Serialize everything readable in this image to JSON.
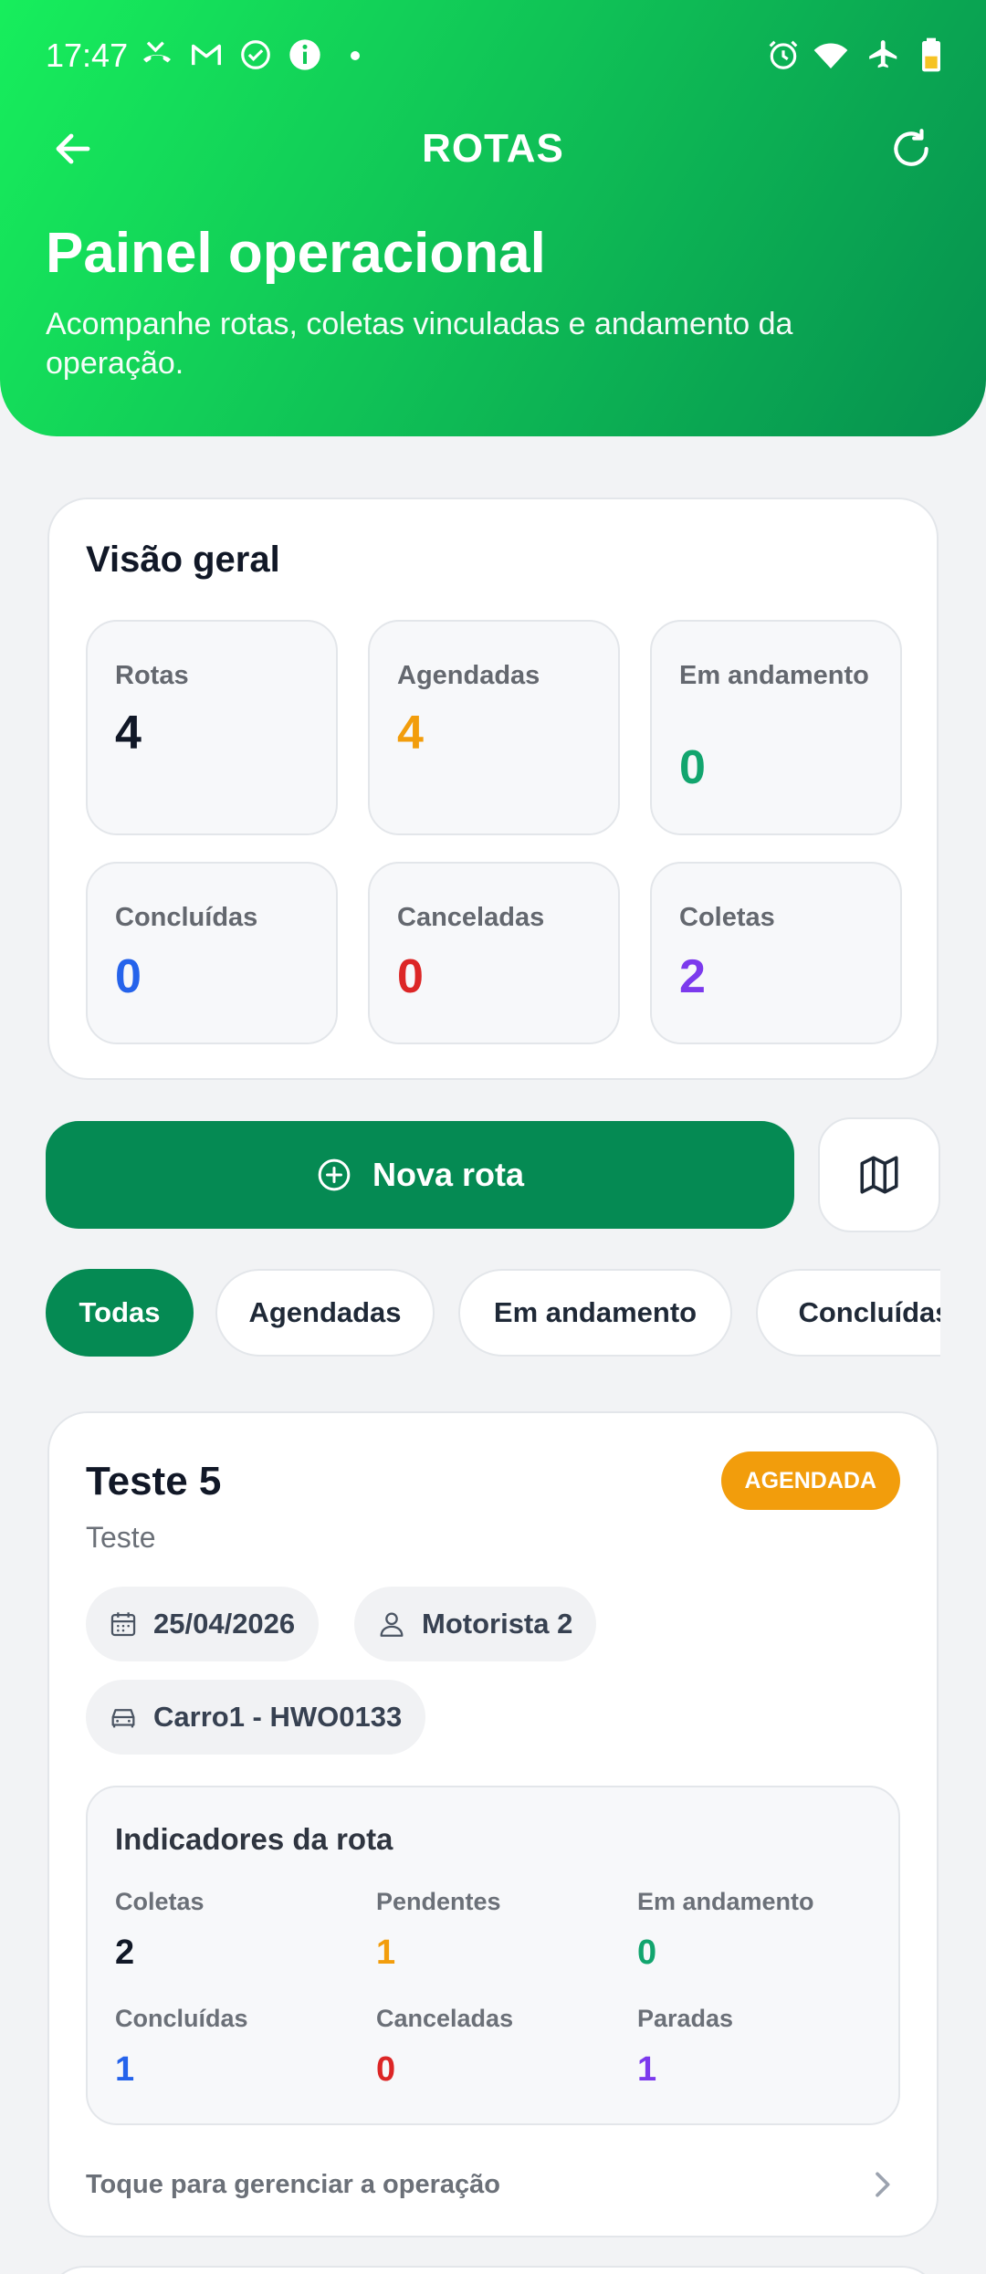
{
  "status_bar": {
    "time": "17:47",
    "left_icons": [
      "missed-call-icon",
      "gmail-icon",
      "check-circle-icon",
      "info-icon",
      "dot-icon"
    ],
    "right_icons": [
      "alarm-icon",
      "wifi-icon",
      "airplane-icon",
      "battery-icon"
    ]
  },
  "topbar": {
    "title": "ROTAS",
    "back_icon": "arrow-left-icon",
    "refresh_icon": "refresh-icon"
  },
  "hero": {
    "title": "Painel operacional",
    "subtitle": "Acompanhe rotas, coletas vinculadas e andamento da operação."
  },
  "overview": {
    "title": "Visão geral",
    "stats": [
      {
        "label": "Rotas",
        "value": "4",
        "color": "#111827"
      },
      {
        "label": "Agendadas",
        "value": "4",
        "color": "#f29d0c"
      },
      {
        "label": "Em andamento",
        "value": "0",
        "color": "#12a56e"
      },
      {
        "label": "Concluídas",
        "value": "0",
        "color": "#2563eb"
      },
      {
        "label": "Canceladas",
        "value": "0",
        "color": "#dc2626"
      },
      {
        "label": "Coletas",
        "value": "2",
        "color": "#7c3aed"
      }
    ]
  },
  "actions": {
    "new_route_label": "Nova rota",
    "new_route_icon": "plus-circle-icon",
    "map_icon": "map-icon"
  },
  "filters": [
    "Todas",
    "Agendadas",
    "Em andamento",
    "Concluídas"
  ],
  "route": {
    "name": "Teste 5",
    "status": "AGENDADA",
    "description": "Teste",
    "date": "25/04/2026",
    "driver": "Motorista 2",
    "vehicle": "Carro1 - HWO0133",
    "indicators_title": "Indicadores da rota",
    "indicators": [
      {
        "label": "Coletas",
        "value": "2",
        "color": "#111827"
      },
      {
        "label": "Pendentes",
        "value": "1",
        "color": "#f29d0c"
      },
      {
        "label": "Em andamento",
        "value": "0",
        "color": "#12a56e"
      },
      {
        "label": "Concluídas",
        "value": "1",
        "color": "#2563eb"
      },
      {
        "label": "Canceladas",
        "value": "0",
        "color": "#dc2626"
      },
      {
        "label": "Paradas",
        "value": "1",
        "color": "#7c3aed"
      }
    ],
    "manage_label": "Toque para gerenciar a operação"
  },
  "colors": {
    "primary": "#058a53",
    "header_gradient_start": "#17ee5c",
    "header_gradient_end": "#06904f",
    "status_scheduled": "#f29d0c"
  }
}
